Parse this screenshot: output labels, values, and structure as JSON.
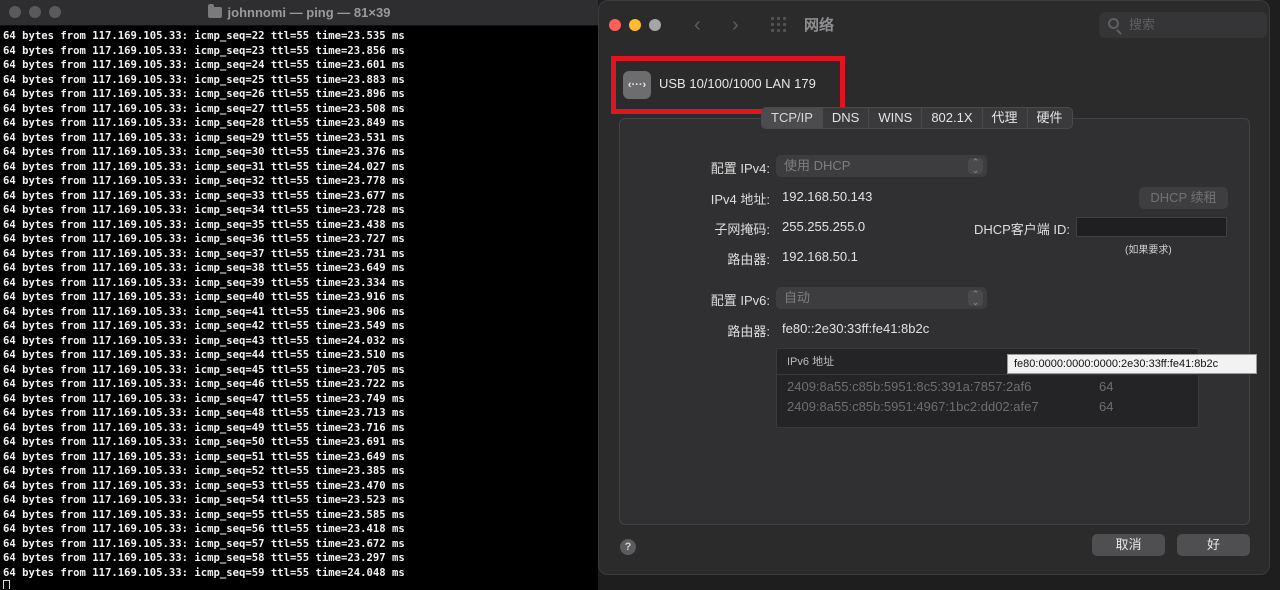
{
  "terminal": {
    "title": "johnnomi — ping — 81×39",
    "lines": [
      "64 bytes from 117.169.105.33: icmp_seq=22 ttl=55 time=23.535 ms",
      "64 bytes from 117.169.105.33: icmp_seq=23 ttl=55 time=23.856 ms",
      "64 bytes from 117.169.105.33: icmp_seq=24 ttl=55 time=23.601 ms",
      "64 bytes from 117.169.105.33: icmp_seq=25 ttl=55 time=23.883 ms",
      "64 bytes from 117.169.105.33: icmp_seq=26 ttl=55 time=23.896 ms",
      "64 bytes from 117.169.105.33: icmp_seq=27 ttl=55 time=23.508 ms",
      "64 bytes from 117.169.105.33: icmp_seq=28 ttl=55 time=23.849 ms",
      "64 bytes from 117.169.105.33: icmp_seq=29 ttl=55 time=23.531 ms",
      "64 bytes from 117.169.105.33: icmp_seq=30 ttl=55 time=23.376 ms",
      "64 bytes from 117.169.105.33: icmp_seq=31 ttl=55 time=24.027 ms",
      "64 bytes from 117.169.105.33: icmp_seq=32 ttl=55 time=23.778 ms",
      "64 bytes from 117.169.105.33: icmp_seq=33 ttl=55 time=23.677 ms",
      "64 bytes from 117.169.105.33: icmp_seq=34 ttl=55 time=23.728 ms",
      "64 bytes from 117.169.105.33: icmp_seq=35 ttl=55 time=23.438 ms",
      "64 bytes from 117.169.105.33: icmp_seq=36 ttl=55 time=23.727 ms",
      "64 bytes from 117.169.105.33: icmp_seq=37 ttl=55 time=23.731 ms",
      "64 bytes from 117.169.105.33: icmp_seq=38 ttl=55 time=23.649 ms",
      "64 bytes from 117.169.105.33: icmp_seq=39 ttl=55 time=23.334 ms",
      "64 bytes from 117.169.105.33: icmp_seq=40 ttl=55 time=23.916 ms",
      "64 bytes from 117.169.105.33: icmp_seq=41 ttl=55 time=23.906 ms",
      "64 bytes from 117.169.105.33: icmp_seq=42 ttl=55 time=23.549 ms",
      "64 bytes from 117.169.105.33: icmp_seq=43 ttl=55 time=24.032 ms",
      "64 bytes from 117.169.105.33: icmp_seq=44 ttl=55 time=23.510 ms",
      "64 bytes from 117.169.105.33: icmp_seq=45 ttl=55 time=23.705 ms",
      "64 bytes from 117.169.105.33: icmp_seq=46 ttl=55 time=23.722 ms",
      "64 bytes from 117.169.105.33: icmp_seq=47 ttl=55 time=23.749 ms",
      "64 bytes from 117.169.105.33: icmp_seq=48 ttl=55 time=23.713 ms",
      "64 bytes from 117.169.105.33: icmp_seq=49 ttl=55 time=23.716 ms",
      "64 bytes from 117.169.105.33: icmp_seq=50 ttl=55 time=23.691 ms",
      "64 bytes from 117.169.105.33: icmp_seq=51 ttl=55 time=23.649 ms",
      "64 bytes from 117.169.105.33: icmp_seq=52 ttl=55 time=23.385 ms",
      "64 bytes from 117.169.105.33: icmp_seq=53 ttl=55 time=23.470 ms",
      "64 bytes from 117.169.105.33: icmp_seq=54 ttl=55 time=23.523 ms",
      "64 bytes from 117.169.105.33: icmp_seq=55 ttl=55 time=23.585 ms",
      "64 bytes from 117.169.105.33: icmp_seq=56 ttl=55 time=23.418 ms",
      "64 bytes from 117.169.105.33: icmp_seq=57 ttl=55 time=23.672 ms",
      "64 bytes from 117.169.105.33: icmp_seq=58 ttl=55 time=23.297 ms",
      "64 bytes from 117.169.105.33: icmp_seq=59 ttl=55 time=24.048 ms"
    ]
  },
  "prefs": {
    "title": "网络",
    "search_placeholder": "搜索",
    "interface_name": "USB 10/100/1000 LAN 179",
    "interface_icon_glyph": "‹···›",
    "tabs": [
      "TCP/IP",
      "DNS",
      "WINS",
      "802.1X",
      "代理",
      "硬件"
    ],
    "active_tab": "TCP/IP",
    "ipv4": {
      "config_label": "配置 IPv4:",
      "config_value": "使用 DHCP",
      "address_label": "IPv4 地址:",
      "address_value": "192.168.50.143",
      "renew_button": "DHCP 续租",
      "subnet_label": "子网掩码:",
      "subnet_value": "255.255.255.0",
      "client_id_label": "DHCP客户端 ID:",
      "client_id_value": "",
      "client_id_hint": "(如果要求)",
      "router_label": "路由器:",
      "router_value": "192.168.50.1"
    },
    "ipv6": {
      "config_label": "配置 IPv6:",
      "config_value": "自动",
      "router_label": "路由器:",
      "router_value": "fe80::2e30:33ff:fe41:8b2c",
      "table_header": "IPv6 地址",
      "tooltip": "fe80:0000:0000:0000:2e30:33ff:fe41:8b2c",
      "addresses": [
        {
          "address": "2409:8a55:c85b:5951:8c5:391a:7857:2af6",
          "prefix": "64"
        },
        {
          "address": "2409:8a55:c85b:5951:4967:1bc2:dd02:afe7",
          "prefix": "64"
        }
      ]
    },
    "help_glyph": "?",
    "cancel_button": "取消",
    "ok_button": "好"
  },
  "colors": {
    "highlight_box": "#e2141f",
    "traffic_close": "#5a5a5c",
    "prefs_close": "#ff5f57",
    "prefs_minimize": "#febc2e",
    "prefs_zoom": "#a5a5a7"
  }
}
